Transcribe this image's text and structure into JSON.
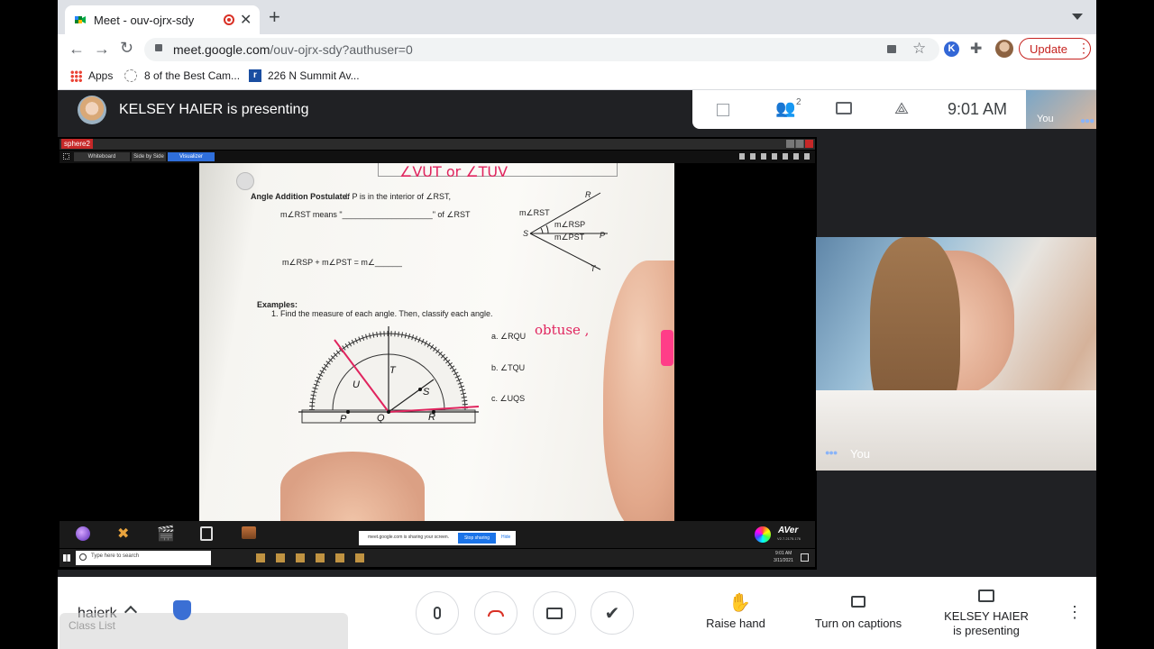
{
  "browser": {
    "tab_title": "Meet - ouv-ojrx-sdy",
    "url_host": "meet.google.com",
    "url_path": "/ouv-ojrx-sdy?authuser=0",
    "update_label": "Update",
    "profile_initial": "K",
    "bookmarks": [
      {
        "label": "Apps"
      },
      {
        "label": "8 of the Best Cam..."
      },
      {
        "label": "226 N Summit Av..."
      }
    ]
  },
  "meet": {
    "presenter_text": "KELSEY HAIER is presenting",
    "participant_count": "2",
    "time": "9:01  AM",
    "self_thumb_label": "You",
    "self_tile_label": "You",
    "bottom": {
      "user_name": "haierk",
      "class_list": "Class List",
      "raise_hand": "Raise hand",
      "captions": "Turn on captions",
      "presenting_line1": "KELSEY HAIER",
      "presenting_line2": "is presenting"
    }
  },
  "remote": {
    "app_name": "sphere2",
    "tabs": [
      "Whiteboard",
      "Side by Side",
      "Visualizer"
    ],
    "share_notice": "meet.google.com is sharing your screen.",
    "stop_sharing": "Stop sharing",
    "hide": "Hide",
    "search_placeholder": "Type here to search",
    "clock_time": "9:01 AM",
    "clock_date": "3/11/2021",
    "aver_brand": "AVer",
    "aver_version": "V2.7.2175.176"
  },
  "worksheet": {
    "top_handwriting": "∠VUT or ∠TUV",
    "postulate_title": "Angle Addition Postulate:",
    "postulate_text": "If P is in the interior of ∠RST,",
    "means_line": "m∠RST means \"____________________\" of ∠RST",
    "sum_line": "m∠RSP + m∠PST = m∠______",
    "examples_title": "Examples:",
    "examples_instruction": "1.   Find the measure of each angle.  Then, classify each angle.",
    "diagram_labels": [
      "m∠RST",
      "m∠RSP",
      "m∠PST",
      "R",
      "S",
      "P",
      "T"
    ],
    "questions": [
      {
        "label": "a.  ∠RQU"
      },
      {
        "label": "b.  ∠TQU"
      },
      {
        "label": "c.  ∠UQS"
      }
    ],
    "answer_handwriting": "obtuse ,",
    "protractor_points": [
      "U",
      "T",
      "S",
      "P",
      "Q",
      "R"
    ]
  },
  "colors": {
    "meet_dark": "#202124",
    "red_button": "#d93025",
    "update_red": "#c5221f",
    "handwriting": "#e0245e",
    "stop_sharing_blue": "#1a73e8"
  }
}
